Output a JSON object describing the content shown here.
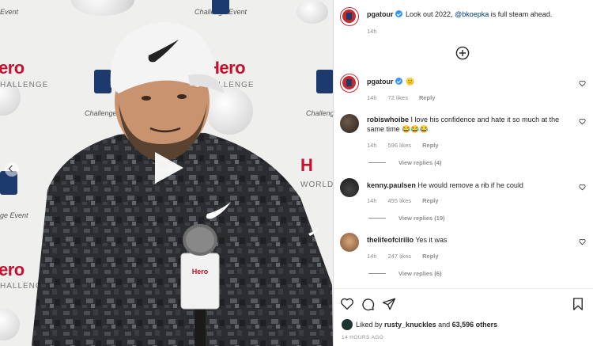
{
  "post": {
    "author": "pgatour",
    "caption_prefix": "Look out 2022,",
    "caption_mention": "@bkoepka",
    "caption_suffix": "is full steam ahead.",
    "time": "14h"
  },
  "comments": [
    {
      "user": "pgatour",
      "verified": true,
      "text": "",
      "emoji": "🙂",
      "time": "14h",
      "likes": "72 likes",
      "reply": "Reply"
    },
    {
      "user": "robiswhoibe",
      "text": "I love his confidence and hate it so much at the same time",
      "emoji": "😂😂😂",
      "time": "14h",
      "likes": "596 likes",
      "reply": "Reply",
      "view_replies": "View replies (4)"
    },
    {
      "user": "kenny.paulsen",
      "text": "He would remove a rib if he could",
      "time": "14h",
      "likes": "455 likes",
      "reply": "Reply",
      "view_replies": "View replies (19)"
    },
    {
      "user": "thelifeofcirillo",
      "text": "Yes it was",
      "time": "14h",
      "likes": "247 likes",
      "reply": "Reply",
      "view_replies": "View replies (6)"
    }
  ],
  "likes": {
    "prefix": "Liked by",
    "user": "rusty_knuckles",
    "middle": "and",
    "count": "63,596 others"
  },
  "posted_ago": "14 HOURS AGO",
  "backdrop": {
    "hero_1": "ero",
    "hero_2": "Hero",
    "hero_3": "ero",
    "hero_4": "H",
    "challenge_1": "HALLENGE",
    "challenge_2": "D CHALLENGE",
    "challenge_3": "HALLENGE",
    "wc": "WORLD CHALLE",
    "event_1": "Challenge Event",
    "event_2": "Challenge Eve",
    "event_3": "Challenge",
    "event_4": "ge Event",
    "event_5": "Event"
  },
  "colors": {
    "accent": "#0095f6",
    "verified": "#3897f0",
    "hero_red": "#c8102e",
    "muted": "#8e8e8e"
  },
  "icons": [
    "play-icon",
    "carousel-prev-icon",
    "add-circle-icon",
    "heart-icon",
    "comment-icon",
    "share-icon",
    "bookmark-icon",
    "verified-icon"
  ]
}
